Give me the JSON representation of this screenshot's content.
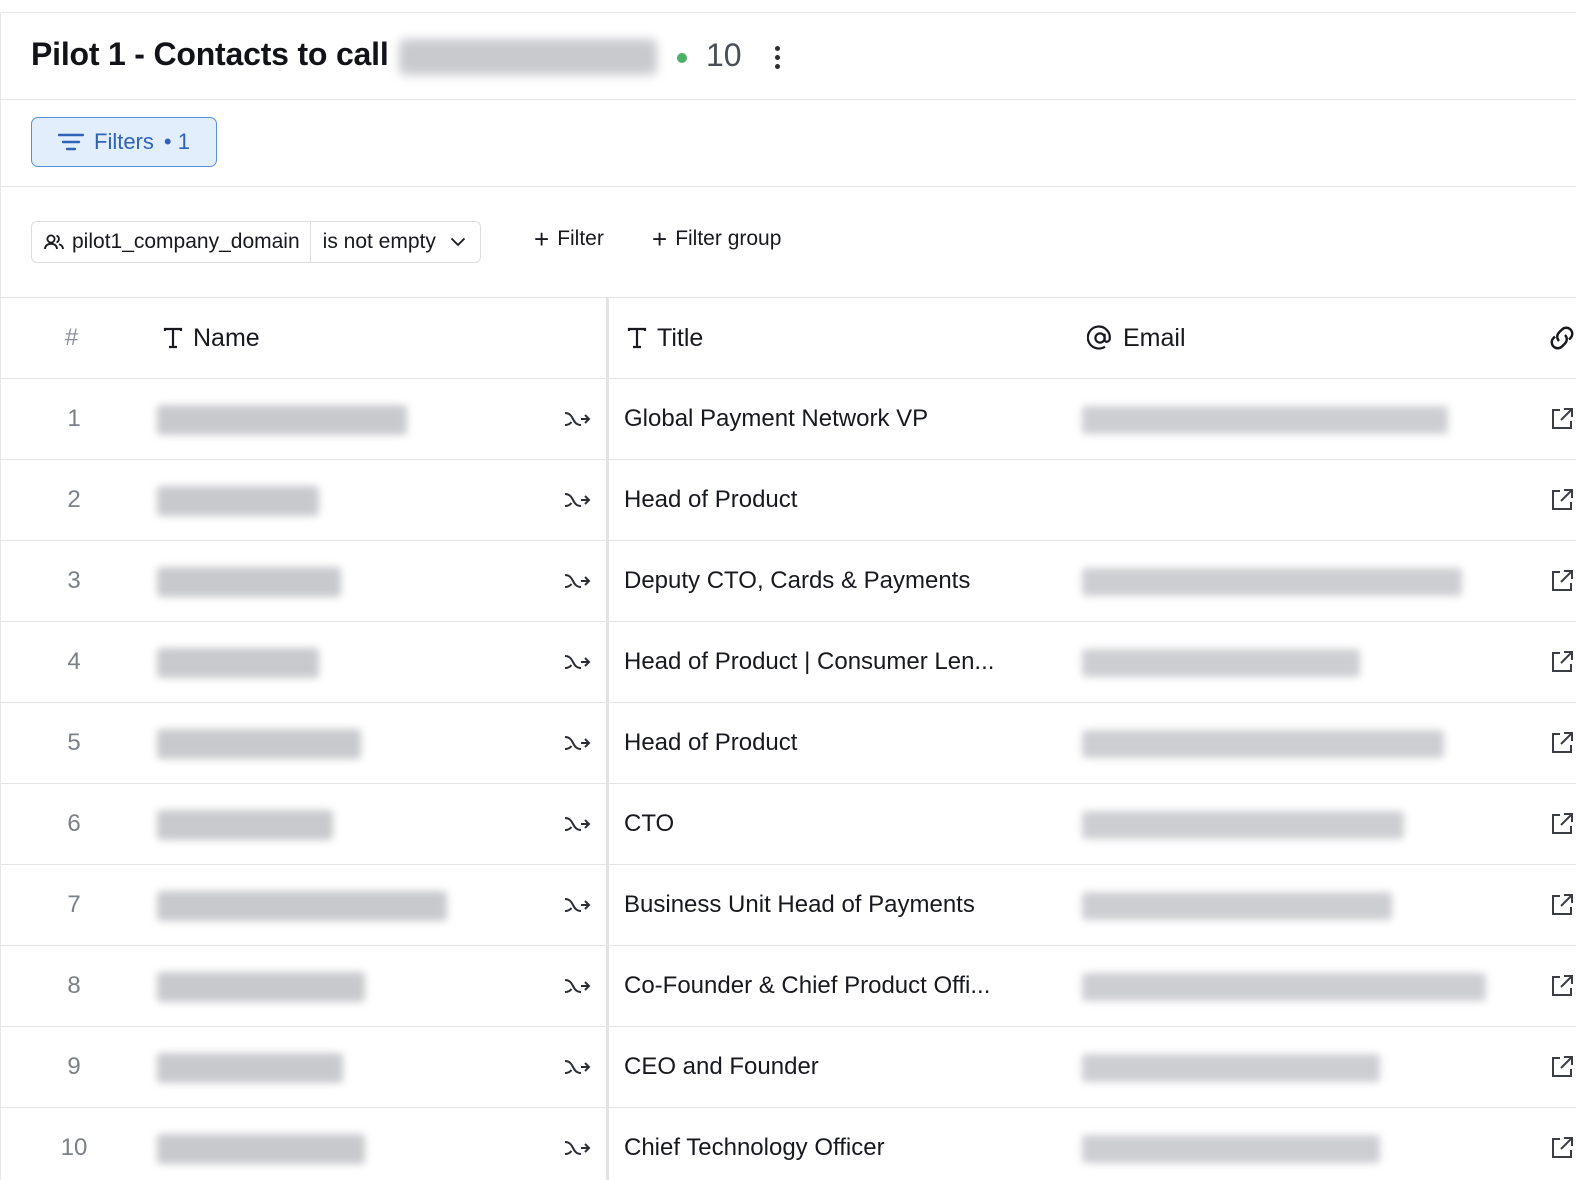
{
  "header": {
    "title": "Pilot 1 - Contacts to call",
    "count": "10",
    "status_color": "#4caf6a"
  },
  "toolbar": {
    "filters_label": "Filters",
    "filters_count": "• 1"
  },
  "filter": {
    "field": "pilot1_company_domain",
    "operator": "is not empty",
    "add_filter_label": "Filter",
    "add_group_label": "Filter group"
  },
  "table": {
    "headers": {
      "num": "#",
      "name": "Name",
      "title": "Title",
      "email": "Email"
    },
    "rows": [
      {
        "num": "1",
        "title": "Global Payment Network VP",
        "has_email": true
      },
      {
        "num": "2",
        "title": "Head of Product",
        "has_email": false
      },
      {
        "num": "3",
        "title": "Deputy CTO, Cards & Payments",
        "has_email": true
      },
      {
        "num": "4",
        "title": "Head of Product | Consumer Len...",
        "has_email": true
      },
      {
        "num": "5",
        "title": "Head of Product",
        "has_email": true
      },
      {
        "num": "6",
        "title": "CTO",
        "has_email": true
      },
      {
        "num": "7",
        "title": "Business Unit Head of Payments",
        "has_email": true
      },
      {
        "num": "8",
        "title": "Co-Founder & Chief Product Offi...",
        "has_email": true
      },
      {
        "num": "9",
        "title": "CEO and Founder",
        "has_email": true
      },
      {
        "num": "10",
        "title": "Chief Technology Officer",
        "has_email": true
      }
    ]
  },
  "accent_color": "#5a8fdd"
}
